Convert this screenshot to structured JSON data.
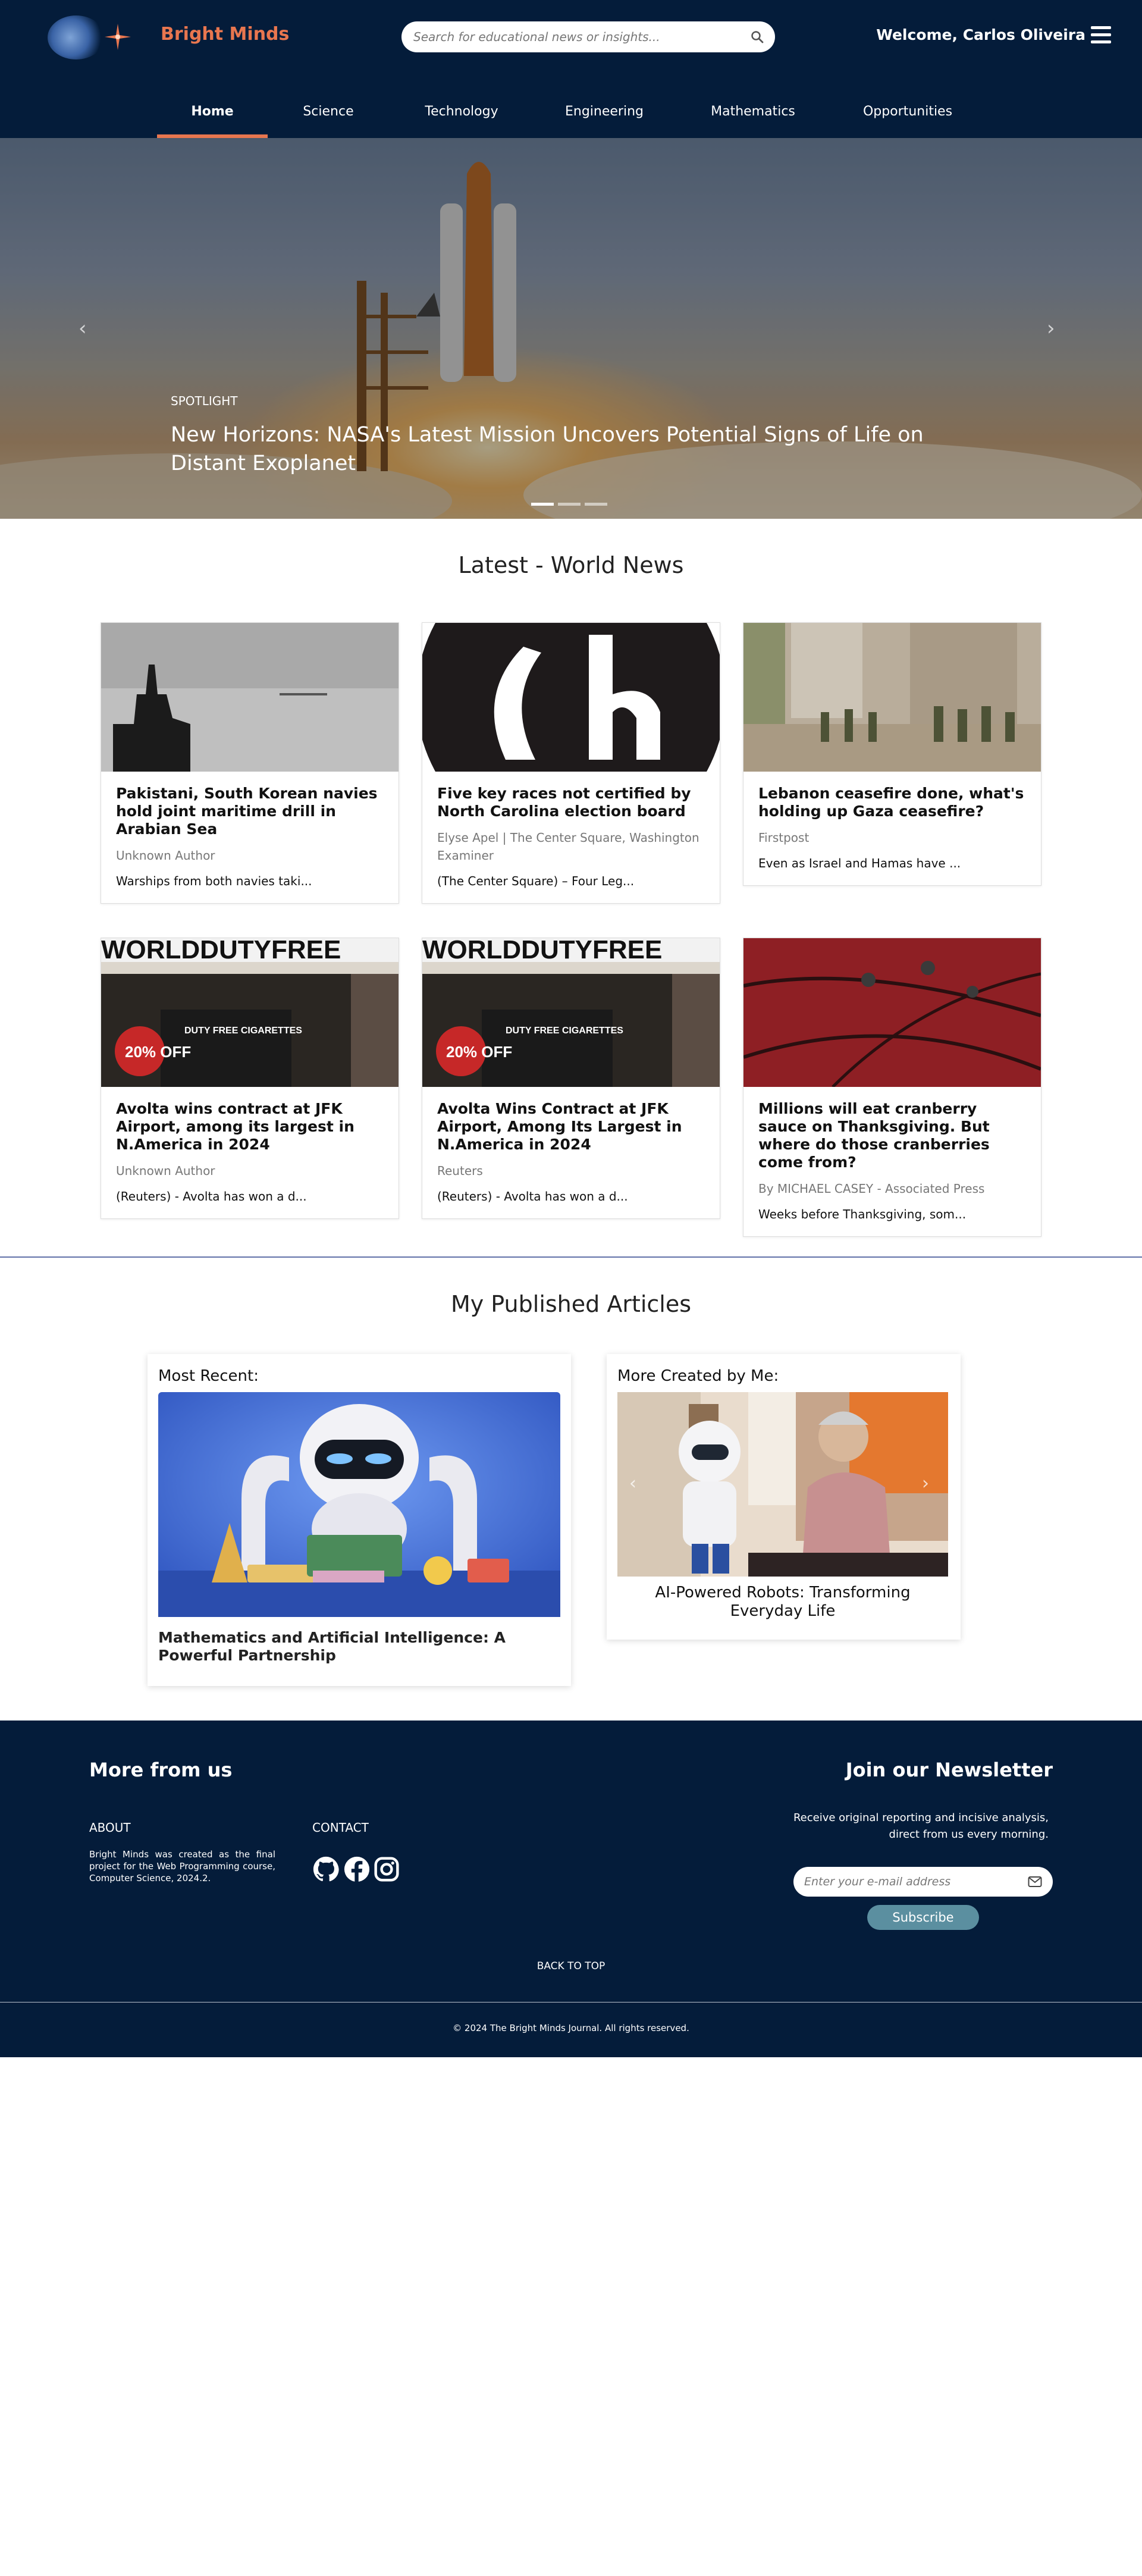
{
  "header": {
    "brand": "Bright Minds",
    "search_placeholder": "Search for educational news or insights...",
    "welcome": "Welcome, Carlos Oliveira"
  },
  "nav": {
    "items": [
      "Home",
      "Science",
      "Technology",
      "Engineering",
      "Mathematics",
      "Opportunities"
    ],
    "active": "Home"
  },
  "hero": {
    "label": "SPOTLIGHT",
    "title": "New Horizons: NASA's Latest Mission Uncovers Potential Signs of Life on Distant Exoplanet",
    "slides": 3,
    "active_slide": 1
  },
  "latest": {
    "title": "Latest - World News",
    "cards": [
      {
        "title": "Pakistani, South Korean navies hold joint maritime drill in Arabian Sea",
        "author": "Unknown Author",
        "desc": "Warships from both navies taki..."
      },
      {
        "title": "Five key races not certified by North Carolina election board",
        "author": "Elyse Apel | The Center Square, Washington Examiner",
        "desc": "(The Center Square) – Four Leg..."
      },
      {
        "title": "Lebanon ceasefire done, what's holding up Gaza ceasefire?",
        "author": "Firstpost",
        "desc": "Even as Israel and Hamas have ..."
      },
      {
        "title": "Avolta wins contract at JFK Airport, among its largest in N.America in 2024",
        "author": "Unknown Author",
        "desc": "(Reuters) - Avolta has won a d..."
      },
      {
        "title": "Avolta Wins Contract at JFK Airport, Among Its Largest in N.America in 2024",
        "author": "Reuters",
        "desc": "(Reuters) - Avolta has won a d..."
      },
      {
        "title": "Millions will eat cranberry sauce on Thanksgiving. But where do those cranberries come from?",
        "author": "By MICHAEL CASEY - Associated Press",
        "desc": "Weeks before Thanksgiving, som..."
      }
    ],
    "store_sign": "WORLDDUTYFREE",
    "store_promo": "20% OFF",
    "store_label": "DUTY FREE CIGARETTES"
  },
  "published": {
    "title": "My Published Articles",
    "recent_label": "Most Recent:",
    "recent_title": "Mathematics and Artificial Intelligence: A Powerful Partnership",
    "more_label": "More Created by Me:",
    "more_title": "AI-Powered Robots: Transforming Everyday Life"
  },
  "footer": {
    "more": "More from us",
    "about_h": "ABOUT",
    "about": "Bright Minds was created as the final project for the Web Programming course, Computer Science, 2024.2.",
    "contact_h": "CONTACT",
    "social": [
      "github-icon",
      "facebook-icon",
      "instagram-icon"
    ],
    "newsletter_h": "Join our Newsletter",
    "newsletter_text": "Receive original reporting and incisive analysis, direct from us every morning.",
    "email_placeholder": "Enter your e-mail address",
    "subscribe": "Subscribe",
    "back_to_top": "BACK TO TOP",
    "copyright": "© 2024 The Bright Minds Journal. All rights reserved."
  },
  "colors": {
    "navy": "#041c3a",
    "accent": "#e8764f",
    "subscribe": "#5b8fa0"
  }
}
